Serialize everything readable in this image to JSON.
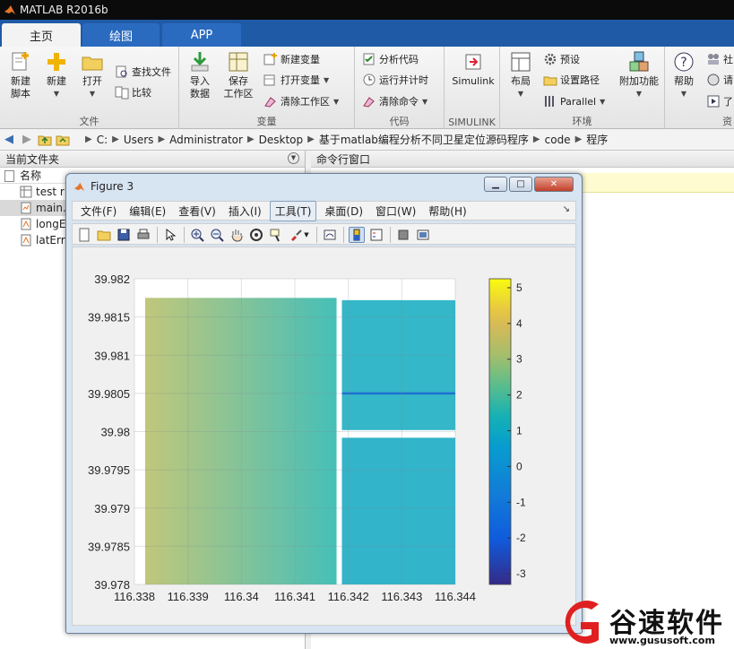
{
  "app": {
    "title": "MATLAB R2016b"
  },
  "ribbon": {
    "tabs": [
      {
        "label": "主页",
        "active": true
      },
      {
        "label": "绘图",
        "active": false
      },
      {
        "label": "APP",
        "active": false
      }
    ],
    "groups": {
      "file": {
        "label": "文件",
        "new_script": "新建\n脚本",
        "new": "新建",
        "open": "打开",
        "find_files": "查找文件",
        "compare": "比较"
      },
      "variable": {
        "label": "变量",
        "import": "导入\n数据",
        "save_ws": "保存\n工作区",
        "new_var": "新建变量",
        "open_var": "打开变量",
        "clear_ws": "清除工作区"
      },
      "code": {
        "label": "代码",
        "analyze": "分析代码",
        "run_time": "运行并计时",
        "clear_cmd": "清除命令"
      },
      "simulink": {
        "label": "SIMULINK",
        "button": "Simulink"
      },
      "environment": {
        "label": "环境",
        "layout": "布局",
        "prefs": "预设",
        "set_path": "设置路径",
        "parallel": "Parallel",
        "addons": "附加功能"
      },
      "resources": {
        "label": "资",
        "help": "帮助",
        "community": "社",
        "request": "请",
        "learn": "了"
      }
    }
  },
  "address": {
    "crumbs": [
      "C:",
      "Users",
      "Administrator",
      "Desktop",
      "基于matlab编程分析不同卫星定位源码程序",
      "code",
      "程序"
    ]
  },
  "file_panel": {
    "title": "当前文件夹",
    "col_name": "名称",
    "items": [
      {
        "name": "test r",
        "icon": "figure-file-icon"
      },
      {
        "name": "main.",
        "icon": "script-file-icon"
      },
      {
        "name": "longE",
        "icon": "mat-file-icon"
      },
      {
        "name": "latErr",
        "icon": "mat-file-icon"
      }
    ]
  },
  "cmd_panel": {
    "title": "命令行窗口"
  },
  "figure": {
    "title": "Figure 3",
    "menu": [
      "文件(F)",
      "编辑(E)",
      "查看(V)",
      "插入(I)",
      "工具(T)",
      "桌面(D)",
      "窗口(W)",
      "帮助(H)"
    ],
    "menu_highlight_index": 4,
    "menu_end_glyph": "↘"
  },
  "chart_data": {
    "type": "heatmap",
    "colormap": "parula",
    "x_ticks": [
      "116.338",
      "116.339",
      "116.34",
      "116.341",
      "116.342",
      "116.343",
      "116.344"
    ],
    "x_tick_values": [
      116.338,
      116.339,
      116.34,
      116.341,
      116.342,
      116.343,
      116.344
    ],
    "y_ticks": [
      "39.982",
      "39.9815",
      "39.981",
      "39.9805",
      "39.98",
      "39.9795",
      "39.979",
      "39.9785",
      "39.978"
    ],
    "y_tick_values": [
      39.982,
      39.9815,
      39.981,
      39.9805,
      39.98,
      39.9795,
      39.979,
      39.9785,
      39.978
    ],
    "xlim": [
      116.338,
      116.344
    ],
    "ylim": [
      39.978,
      39.982
    ],
    "colorbar_ticks": [
      "5",
      "4",
      "3",
      "2",
      "1",
      "0",
      "-1",
      "-2",
      "-3"
    ],
    "colorbar_tick_values": [
      5,
      4,
      3,
      2,
      1,
      0,
      -1,
      -2,
      -3
    ],
    "clim": [
      -3.3,
      5.25
    ],
    "grid": true,
    "regions": [
      {
        "x": [
          116.3382,
          116.34178
        ],
        "y": [
          39.978,
          39.98175
        ],
        "value_left": 3.4,
        "value_right": 1.6
      },
      {
        "x": [
          116.34188,
          116.344
        ],
        "y": [
          39.98002,
          39.98172
        ],
        "value_left": 1.1,
        "value_right": 1.1
      },
      {
        "x": [
          116.34188,
          116.344
        ],
        "y": [
          39.978,
          39.97992
        ],
        "value_left": 1.0,
        "value_right": 1.0
      }
    ],
    "streak": {
      "y": 39.9805,
      "x": [
        116.34188,
        116.344
      ],
      "value": -1.7
    }
  },
  "watermark": {
    "text": "谷速软件",
    "url": "www.gususoft.com"
  },
  "colors": {
    "ribbon_tab_bar": "#1f5aa6",
    "title_bar": "#0b0b0b",
    "figure_frame": "#d7e4f2",
    "watermark_red": "#e02020"
  }
}
